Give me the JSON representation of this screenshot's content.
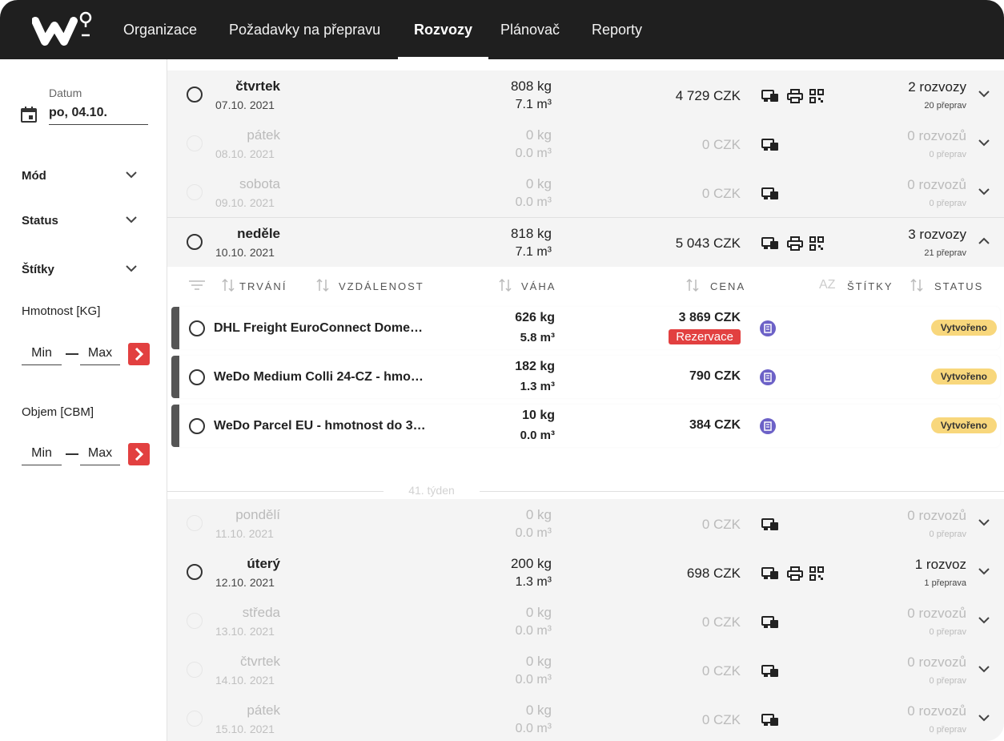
{
  "nav": {
    "items": [
      {
        "label": "Organizace",
        "active": false
      },
      {
        "label": "Požadavky na přepravu",
        "active": false
      },
      {
        "label": "Rozvozy",
        "active": true
      },
      {
        "label": "Plánovač",
        "active": false
      },
      {
        "label": "Reporty",
        "active": false
      }
    ]
  },
  "sidebar": {
    "date_label": "Datum",
    "date_value": "po, 04.10.",
    "filters": [
      {
        "label": "Mód"
      },
      {
        "label": "Status"
      },
      {
        "label": "Štítky"
      }
    ],
    "weight": {
      "label": "Hmotnost [KG]",
      "min": "Min",
      "max": "Max"
    },
    "volume": {
      "label": "Objem [CBM]",
      "min": "Min",
      "max": "Max"
    }
  },
  "days_top": [
    {
      "name": "čtvrtek",
      "date": "07.10. 2021",
      "weight": "808 kg",
      "volume": "7.1 m³",
      "price": "4 729 CZK",
      "count": "2 rozvozy",
      "sub": "20 přeprav",
      "active": true,
      "icons": [
        "map-icon",
        "print-icon",
        "qr-icon"
      ]
    },
    {
      "name": "pátek",
      "date": "08.10. 2021",
      "weight": "0 kg",
      "volume": "0.0 m³",
      "price": "0 CZK",
      "count": "0 rozvozů",
      "sub": "0 přeprav",
      "active": false,
      "icons": [
        "map-icon"
      ]
    },
    {
      "name": "sobota",
      "date": "09.10. 2021",
      "weight": "0 kg",
      "volume": "0.0 m³",
      "price": "0 CZK",
      "count": "0 rozvozů",
      "sub": "0 přeprav",
      "active": false,
      "icons": [
        "map-icon"
      ]
    },
    {
      "name": "neděle",
      "date": "10.10. 2021",
      "weight": "818 kg",
      "volume": "7.1 m³",
      "price": "5 043 CZK",
      "count": "3 rozvozy",
      "sub": "21 přeprav",
      "active": true,
      "expanded": true,
      "icons": [
        "map-icon",
        "print-icon",
        "qr-icon"
      ]
    }
  ],
  "columns": {
    "duration": "TRVÁNÍ",
    "distance": "VZDÁLENOST",
    "weight": "VÁHA",
    "price": "CENA",
    "tags": "ŠTÍTKY",
    "status": "STATUS",
    "az": "AZ"
  },
  "items": [
    {
      "name": "DHL Freight EuroConnect Dome…",
      "weight": "626 kg",
      "volume": "5.8 m³",
      "price": "3 869 CZK",
      "badge": "Rezervace",
      "status": "Vytvořeno"
    },
    {
      "name": "WeDo Medium Colli 24-CZ - hmo…",
      "weight": "182 kg",
      "volume": "1.3 m³",
      "price": "790 CZK",
      "status": "Vytvořeno"
    },
    {
      "name": "WeDo Parcel EU - hmotnost do 3…",
      "weight": "10 kg",
      "volume": "0.0 m³",
      "price": "384 CZK",
      "status": "Vytvořeno"
    }
  ],
  "week_label": "41. týden",
  "days_bottom": [
    {
      "name": "pondělí",
      "date": "11.10. 2021",
      "weight": "0 kg",
      "volume": "0.0 m³",
      "price": "0 CZK",
      "count": "0 rozvozů",
      "sub": "0 přeprav",
      "active": false,
      "icons": [
        "map-icon"
      ]
    },
    {
      "name": "úterý",
      "date": "12.10. 2021",
      "weight": "200 kg",
      "volume": "1.3 m³",
      "price": "698 CZK",
      "count": "1 rozvoz",
      "sub": "1 přeprava",
      "active": true,
      "icons": [
        "map-icon",
        "print-icon",
        "qr-icon"
      ]
    },
    {
      "name": "středa",
      "date": "13.10. 2021",
      "weight": "0 kg",
      "volume": "0.0 m³",
      "price": "0 CZK",
      "count": "0 rozvozů",
      "sub": "0 přeprav",
      "active": false,
      "icons": [
        "map-icon"
      ]
    },
    {
      "name": "čtvrtek",
      "date": "14.10. 2021",
      "weight": "0 kg",
      "volume": "0.0 m³",
      "price": "0 CZK",
      "count": "0 rozvozů",
      "sub": "0 přeprav",
      "active": false,
      "icons": [
        "map-icon"
      ]
    },
    {
      "name": "pátek",
      "date": "15.10. 2021",
      "weight": "0 kg",
      "volume": "0.0 m³",
      "price": "0 CZK",
      "count": "0 rozvozů",
      "sub": "0 přeprav",
      "active": false,
      "icons": [
        "map-icon"
      ]
    }
  ]
}
